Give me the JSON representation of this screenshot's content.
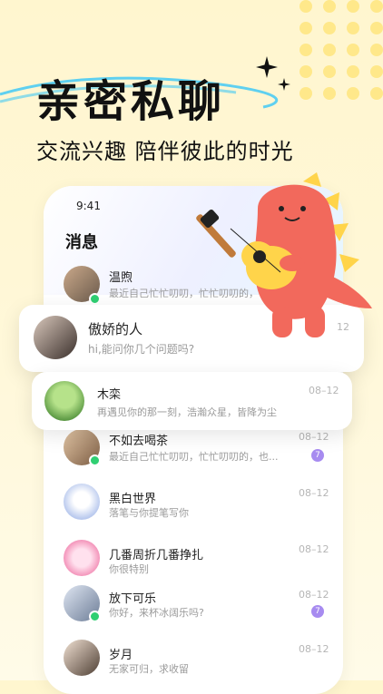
{
  "headline": "亲密私聊",
  "subtitle": "交流兴趣 陪伴彼此的时光",
  "phone": {
    "time": "9:41",
    "title": "消息"
  },
  "conversations": [
    {
      "name": "温煦",
      "preview": "最近自己忙忙叨叨，忙忙叨叨的，",
      "stamp": "",
      "badge": "",
      "online": true
    },
    {
      "name": "傲娇的人",
      "preview": "hi,能问你几个问题吗?",
      "stamp": "12",
      "badge": "",
      "online": false
    },
    {
      "name": "木栾",
      "preview": "再遇见你的那一刻，浩瀚众星，皆降为尘",
      "stamp": "08–12",
      "badge": "",
      "online": false
    },
    {
      "name": "不如去喝茶",
      "preview": "最近自己忙忙叨叨，忙忙叨叨的，也...",
      "stamp": "08–12",
      "badge": "7",
      "online": true
    },
    {
      "name": "黑白世界",
      "preview": "落笔与你提笔写你",
      "stamp": "08–12",
      "badge": "",
      "online": false
    },
    {
      "name": "几番周折几番挣扎",
      "preview": "你很特别",
      "stamp": "08–12",
      "badge": "",
      "online": false
    },
    {
      "name": "放下可乐",
      "preview": "你好，来杯冰阔乐吗?",
      "stamp": "08–12",
      "badge": "7",
      "online": true
    },
    {
      "name": "岁月",
      "preview": "无家可归，求收留",
      "stamp": "08–12",
      "badge": "",
      "online": false
    }
  ],
  "colors": {
    "accent_yellow": "#ffe070",
    "online_green": "#2fcf72",
    "badge_purple": "#a78bf0",
    "dino_red": "#f2695c",
    "swoosh_blue": "#5fd0f0"
  }
}
